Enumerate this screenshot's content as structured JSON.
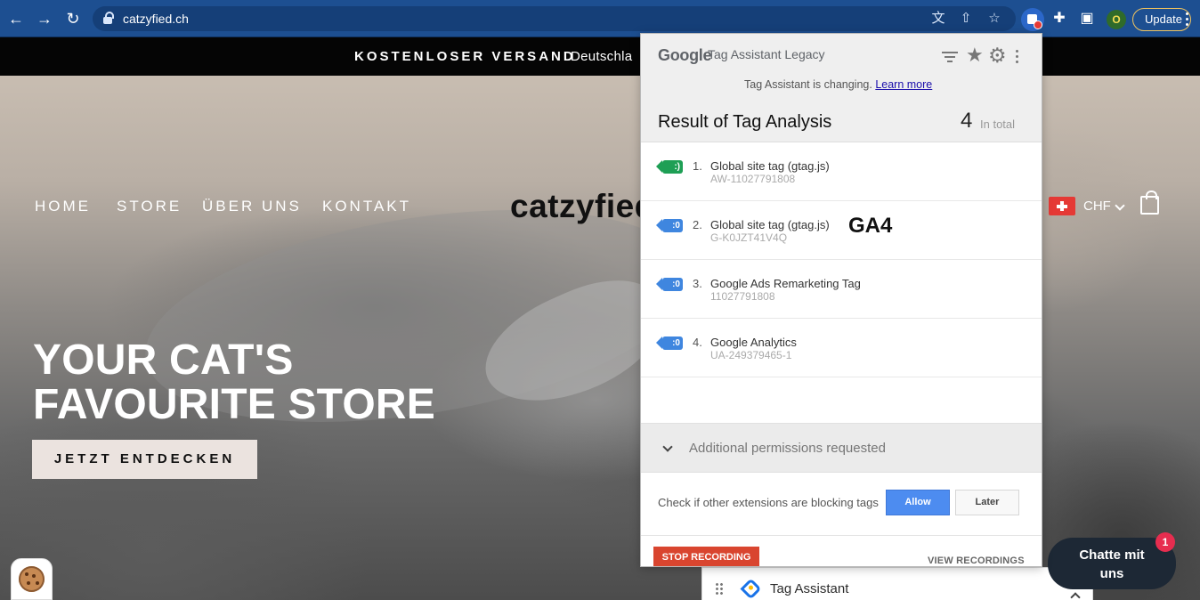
{
  "browser": {
    "url": "catzyfied.ch",
    "update_label": "Update",
    "profile_initial": "O"
  },
  "site": {
    "announcement_bold": "KOSTENLOSER VERSAND",
    "announcement_rest": "Deutschla",
    "menu": [
      "HOME",
      "STORE",
      "ÜBER UNS",
      "KONTAKT"
    ],
    "logo": "catzyfied",
    "currency": "CHF",
    "hero_title_line1": "YOUR CAT'S",
    "hero_title_line2": "FAVOURITE STORE",
    "hero_button": "JETZT ENTDECKEN",
    "chat_line1": "Chatte mit",
    "chat_line2": "uns",
    "chat_badge": "1"
  },
  "popup": {
    "google_word": "Google",
    "product": "Tag Assistant Legacy",
    "changing_text": "Tag Assistant is changing.",
    "learn_more": "Learn more",
    "result_title": "Result of Tag Analysis",
    "total_count": "4",
    "total_label": "In total",
    "tags": [
      {
        "index": "1.",
        "name": "Global site tag (gtag.js)",
        "id": "AW-11027791808",
        "color": "green"
      },
      {
        "index": "2.",
        "name": "Global site tag (gtag.js)",
        "id": "G-K0JZT41V4Q",
        "color": "blue",
        "annotation": "GA4"
      },
      {
        "index": "3.",
        "name": "Google Ads Remarketing Tag",
        "id": "11027791808",
        "color": "blue"
      },
      {
        "index": "4.",
        "name": "Google Analytics",
        "id": "UA-249379465-1",
        "color": "blue"
      }
    ],
    "permissions_text": "Additional permissions requested",
    "check_text": "Check if other extensions are blocking tags",
    "allow_label": "Allow",
    "later_label": "Later",
    "stop_recording": "STOP RECORDING",
    "view_recordings": "VIEW RECORDINGS"
  },
  "tag_assistant_bar": {
    "label": "Tag Assistant"
  },
  "icons": {
    "back": "arrow-left-icon",
    "forward": "arrow-right-icon",
    "reload": "reload-icon",
    "lock": "lock-icon",
    "translate": "translate-icon",
    "share": "share-icon",
    "bookmark": "star-icon",
    "tag_assistant_extension": "tag-assistant-icon",
    "extensions": "puzzle-icon",
    "side_panel": "side-panel-icon",
    "menu": "kebab-icon",
    "cart": "cart-icon",
    "cookie": "cookie-icon",
    "filter": "filter-icon",
    "settings": "gear-icon",
    "more": "more-icon"
  },
  "colors": {
    "chrome": "#1d4f91",
    "tag_green": "#1e9f55",
    "tag_blue": "#3f86df",
    "allow": "#4d8cf0",
    "stop_recording": "#d9452f",
    "chat": "#1d2835"
  }
}
